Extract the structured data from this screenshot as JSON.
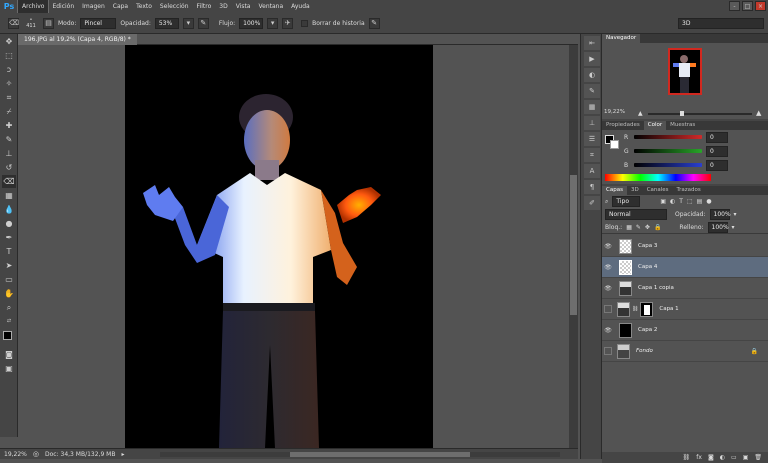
{
  "menu": {
    "logo": "Ps",
    "items": [
      "Archivo",
      "Edición",
      "Imagen",
      "Capa",
      "Texto",
      "Selección",
      "Filtro",
      "3D",
      "Vista",
      "Ventana",
      "Ayuda"
    ],
    "window_controls": [
      "-",
      "□",
      "×"
    ]
  },
  "options": {
    "brush_size": "411",
    "mode_label": "Modo:",
    "mode_value": "Pincel",
    "opacity_label": "Opacidad:",
    "opacity_value": "53%",
    "flow_label": "Flujo:",
    "flow_value": "100%",
    "history_label": "Borrar de historia",
    "workspace": "3D"
  },
  "document": {
    "tab_title": "196.JPG al 19,2% (Capa 4, RGB/8) *",
    "zoom": "19,22%",
    "doc_info": "Doc: 34,3 MB/132,9 MB"
  },
  "navigator": {
    "tab": "Navegador",
    "zoom": "19,22%"
  },
  "color_panel": {
    "tabs": [
      "Propiedades",
      "Color",
      "Muestras"
    ],
    "active_tab": "Color",
    "channels": [
      {
        "label": "R",
        "value": "0",
        "color": "#d12a2a"
      },
      {
        "label": "G",
        "value": "0",
        "color": "#28a528"
      },
      {
        "label": "B",
        "value": "0",
        "color": "#2a3fd1"
      }
    ]
  },
  "layers_panel": {
    "tabs": [
      "Capas",
      "3D",
      "Canales",
      "Trazados"
    ],
    "active_tab": "Capas",
    "filter_kind": "Tipo",
    "blend_mode": "Normal",
    "opacity_label": "Opacidad:",
    "opacity_value": "100%",
    "lock_label": "Bloq.:",
    "fill_label": "Relleno:",
    "fill_value": "100%",
    "layers": [
      {
        "name": "Capa 3",
        "visible": true,
        "selected": false
      },
      {
        "name": "Capa 4",
        "visible": true,
        "selected": true
      },
      {
        "name": "Capa 1 copia",
        "visible": true,
        "selected": false
      },
      {
        "name": "Capa 1",
        "visible": false,
        "selected": false
      },
      {
        "name": "Capa 2",
        "visible": true,
        "selected": false
      },
      {
        "name": "Fondo",
        "visible": false,
        "selected": false
      }
    ],
    "bottom_icons": [
      "link-icon",
      "fx-icon",
      "mask-icon",
      "adjustment-icon",
      "group-icon",
      "new-layer-icon",
      "trash-icon"
    ]
  }
}
